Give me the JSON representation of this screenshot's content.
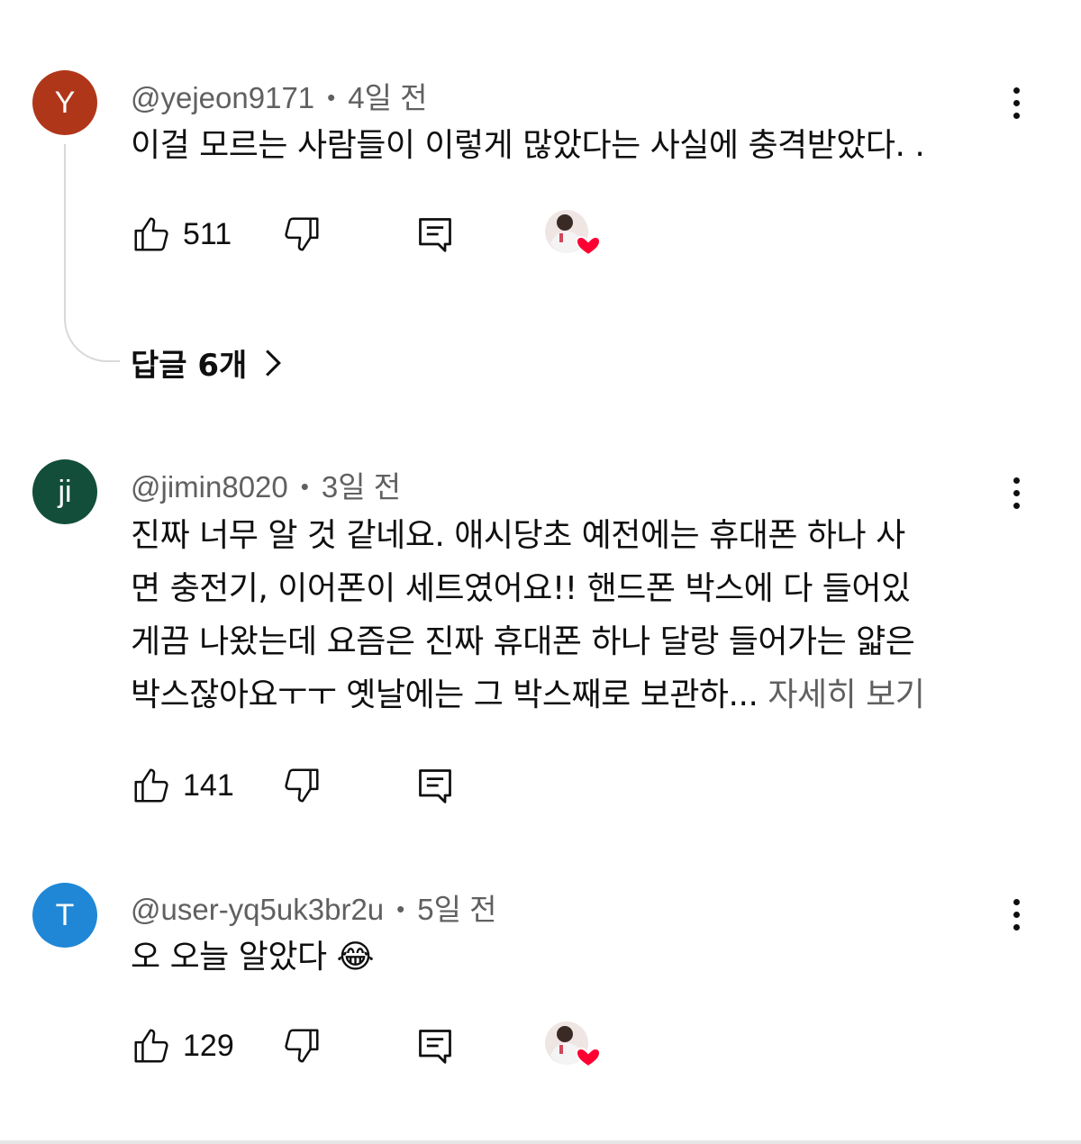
{
  "comments": [
    {
      "avatar_letter": "Y",
      "avatar_color": "#b0361a",
      "author": "@yejeon9171",
      "separator": "•",
      "time": "4일 전",
      "text": "이걸 모르는 사람들이 이렇게 많았다는 사실에 충격받았다. .",
      "likes": "511",
      "creator_hearted": true,
      "replies_label": "답글 6개"
    },
    {
      "avatar_letter": "ji",
      "avatar_color": "#134e3a",
      "author": "@jimin8020",
      "separator": "•",
      "time": "3일 전",
      "text": "진짜 너무 알 것 같네요. 애시당초 예전에는 휴대폰 하나 사\n면 충전기, 이어폰이 세트였어요!! 핸드폰 박스에 다 들어있\n게끔 나왔는데 요즘은 진짜 휴대폰 하나 달랑 들어가는 얇은\n박스잖아요ㅜㅜ 옛날에는 그 박스째로 보관하...",
      "read_more": "자세히 보기",
      "likes": "141",
      "creator_hearted": false
    },
    {
      "avatar_letter": "T",
      "avatar_color": "#1f87d6",
      "author": "@user-yq5uk3br2u",
      "separator": "•",
      "time": "5일 전",
      "text": "오 오늘 알았다 😂",
      "likes": "129",
      "creator_hearted": true
    }
  ],
  "icons": {
    "like": "thumbs-up-icon",
    "dislike": "thumbs-down-icon",
    "reply": "reply-comment-icon",
    "more": "more-vert-icon",
    "creator_heart": "creator-heart-icon",
    "chevron": "chevron-right-icon"
  }
}
